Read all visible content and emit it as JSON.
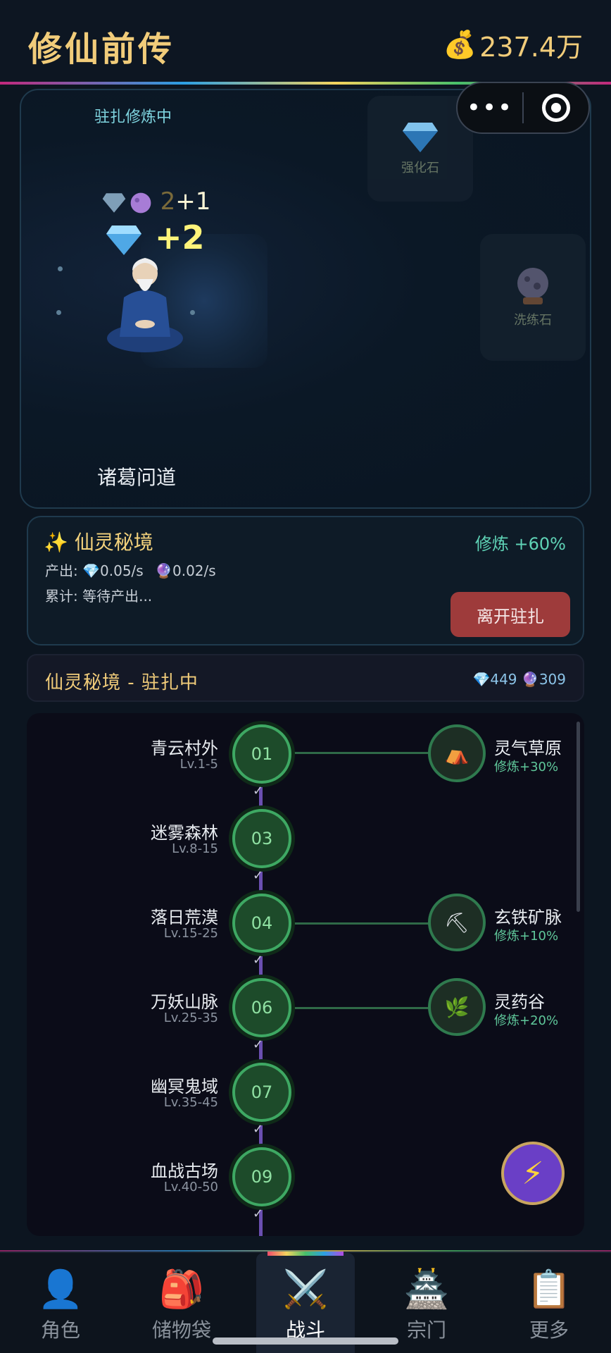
{
  "header": {
    "title": "修仙前传",
    "gold_value": "237.4万"
  },
  "miniprogram": {
    "more_label": "•••"
  },
  "scene": {
    "status": "驻扎修炼中",
    "cards": [
      {
        "label": "强化石",
        "icon": "diamond-icon"
      },
      {
        "label": "洗练石",
        "icon": "orb-icon"
      }
    ],
    "float_text_small": "+1",
    "float_text_large": "+2",
    "float_partial_digit": "2",
    "character_name": "诸葛问道"
  },
  "realm": {
    "title": "仙灵秘境",
    "bonus": "修炼 +60%",
    "production_label": "产出:",
    "prod_diamond": "0.05/s",
    "prod_orb": "0.02/s",
    "accumulated": "累计: 等待产出...",
    "leave_button": "离开驻扎"
  },
  "station": {
    "title": "仙灵秘境 - 驻扎中",
    "diamond_count": "449",
    "orb_count": "309"
  },
  "map": {
    "zones": [
      {
        "number": "01",
        "name": "青云村外",
        "level": "Lv.1-5"
      },
      {
        "number": "03",
        "name": "迷雾森林",
        "level": "Lv.8-15"
      },
      {
        "number": "04",
        "name": "落日荒漠",
        "level": "Lv.15-25"
      },
      {
        "number": "06",
        "name": "万妖山脉",
        "level": "Lv.25-35"
      },
      {
        "number": "07",
        "name": "幽冥鬼域",
        "level": "Lv.35-45"
      },
      {
        "number": "09",
        "name": "血战古场",
        "level": "Lv.40-50"
      }
    ],
    "sub_areas": [
      {
        "name": "灵气草原",
        "bonus": "修炼+30%",
        "icon": "camp-icon"
      },
      {
        "name": "玄铁矿脉",
        "bonus": "修炼+10%",
        "icon": "pickaxe-icon"
      },
      {
        "name": "灵药谷",
        "bonus": "修炼+20%",
        "icon": "herb-icon"
      }
    ],
    "check_mark": "✓"
  },
  "nav": {
    "items": [
      {
        "label": "角色",
        "icon": "person-icon"
      },
      {
        "label": "储物袋",
        "icon": "backpack-icon"
      },
      {
        "label": "战斗",
        "icon": "crossed-swords-icon"
      },
      {
        "label": "宗门",
        "icon": "pagoda-icon"
      },
      {
        "label": "更多",
        "icon": "clipboard-icon"
      }
    ],
    "active_index": 2
  },
  "colors": {
    "accent_gold": "#f1cc7a",
    "node_green": "#3ea863",
    "leave_red": "#9e3b3b",
    "path_purple": "#6a4fb0"
  }
}
